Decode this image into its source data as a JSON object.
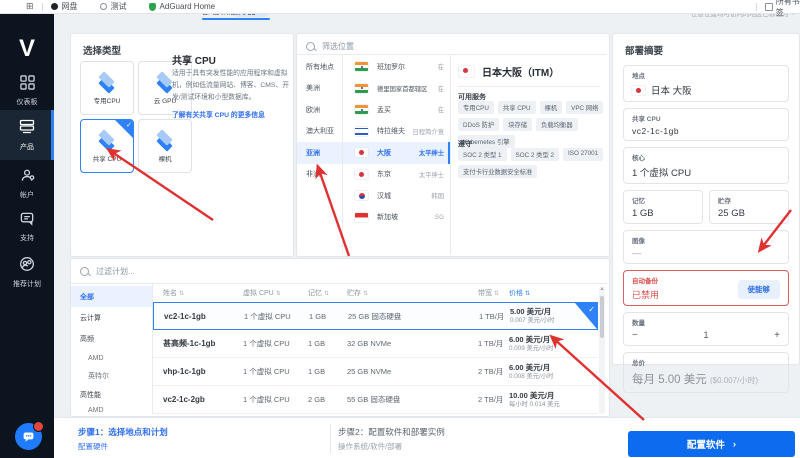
{
  "colors": {
    "accent": "#2f81f7",
    "brand_button": "#0d6bf0",
    "danger": "#d9534f",
    "sidebar_bg": "#0b141f"
  },
  "browser": {
    "bookmarks": [
      {
        "label": "网盘"
      },
      {
        "label": "测试"
      },
      {
        "label": "AdGuard Home"
      }
    ],
    "all_bookmarks": "所有书签"
  },
  "topstrip": {
    "tab": "部署新服务器",
    "hint": "任意位置均可访问的地区已标记为 ~"
  },
  "sidebar": {
    "logo": "V",
    "items": [
      {
        "label": "仪表板"
      },
      {
        "label": "产品"
      },
      {
        "label": "帐户"
      },
      {
        "label": "支持"
      },
      {
        "label": "推荐计划"
      }
    ]
  },
  "type_panel": {
    "title": "选择类型",
    "cards": [
      {
        "label": "专用CPU"
      },
      {
        "label": "云 GPU"
      },
      {
        "label": "共享 CPU"
      },
      {
        "label": "裸机"
      }
    ],
    "detail": {
      "title": "共享 CPU",
      "desc": "适用于具有突发性能的应用程序和虚拟机，例如低流量网站、博客、CMS、开发/测试环境和小型数据库。",
      "link": "了解有关共享 CPU 的更多信息"
    }
  },
  "location_panel": {
    "search_placeholder": "筛选位置",
    "regions": [
      {
        "label": "所有地点"
      },
      {
        "label": "美洲"
      },
      {
        "label": "欧洲"
      },
      {
        "label": "澳大利亚"
      },
      {
        "label": "亚洲"
      },
      {
        "label": "非洲"
      }
    ],
    "cities": [
      {
        "name": "班加罗尔",
        "meta": "在"
      },
      {
        "name": "德里国家首都辖区",
        "meta": "在"
      },
      {
        "name": "孟买",
        "meta": "在"
      },
      {
        "name": "特拉维夫",
        "meta": "日程简介意"
      },
      {
        "name": "大阪",
        "meta": "太平绅士"
      },
      {
        "name": "东京",
        "meta": "太平绅士"
      },
      {
        "name": "汉城",
        "meta": "韩国"
      },
      {
        "name": "新加坡",
        "meta": "SG"
      }
    ],
    "detail": {
      "title": "日本大阪（ITM）",
      "services_label": "可用服务",
      "services": [
        {
          "label": "专用CPU"
        },
        {
          "label": "共享 CPU"
        },
        {
          "label": "裸机"
        },
        {
          "label": "VPC 网络"
        },
        {
          "label": "DDoS 防护"
        },
        {
          "label": "块存储"
        },
        {
          "label": "负载均衡器"
        },
        {
          "label": "Kubernetes 引擎"
        }
      ],
      "compliance_label": "遵守",
      "compliance": [
        {
          "label": "SOC 2 类型 1"
        },
        {
          "label": "SOC 2 类型 2"
        },
        {
          "label": "ISO 27001"
        },
        {
          "label": "支付卡行业数据安全标准"
        }
      ]
    }
  },
  "plans_panel": {
    "search_placeholder": "过滤计划...",
    "filters": [
      {
        "label": "全部"
      },
      {
        "label": "云计算"
      },
      {
        "label": "高频"
      },
      {
        "label": "AMD"
      },
      {
        "label": "英特尔"
      },
      {
        "label": "高性能"
      },
      {
        "label": "AMD"
      }
    ],
    "columns": [
      {
        "label": "姓名"
      },
      {
        "label": "虚拟 CPU"
      },
      {
        "label": "记忆"
      },
      {
        "label": "贮存"
      },
      {
        "label": "带宽"
      },
      {
        "label": "价格"
      }
    ],
    "rows": [
      {
        "name": "vc2-1c-1gb",
        "cpu": "1 个虚拟 CPU",
        "mem": "1 GB",
        "storage": "25 GB 固态硬盘",
        "bw": "1 TB/月",
        "price": "5.00 美元/月",
        "price_sub": "0.007 美元/小时"
      },
      {
        "name": "甚高频-1c-1gb",
        "cpu": "1 个虚拟 CPU",
        "mem": "1 GB",
        "storage": "32 GB NVMe",
        "bw": "1 TB/月",
        "price": "6.00 美元/月",
        "price_sub": "0.009 美元/小时"
      },
      {
        "name": "vhp-1c-1gb",
        "cpu": "1 个虚拟 CPU",
        "mem": "1 GB",
        "storage": "25 GB NVMe",
        "bw": "2 TB/月",
        "price": "6.00 美元/月",
        "price_sub": "0.008 美元/小时"
      },
      {
        "name": "vc2-1c-2gb",
        "cpu": "1 个虚拟 CPU",
        "mem": "2 GB",
        "storage": "55 GB 固态硬盘",
        "bw": "2 TB/月",
        "price": "10.00 美元/月",
        "price_sub": "每小时 0.014 美元"
      }
    ]
  },
  "steps": {
    "step1": "步骤1：选择地点和计划",
    "step1_sub": "配置硬件",
    "step2": "步骤2：配置软件和部署实例",
    "step2_sub": "操作系统/软件/部署"
  },
  "summary": {
    "title": "部署摘要",
    "location_label": "地点",
    "location_value": "日本 大阪",
    "cpu_label": "共享 CPU",
    "cpu_value": "vc2-1c-1gb",
    "core_label": "核心",
    "core_value": "1 个虚拟 CPU",
    "mem_label": "记忆",
    "mem_value": "1 GB",
    "storage_label": "贮存",
    "storage_value": "25 GB",
    "image_label": "图像",
    "image_value": "—",
    "backup_label": "自动备份",
    "backup_status": "已禁用",
    "backup_button": "使能够",
    "qty_label": "数量",
    "qty_minus": "−",
    "qty_value": "1",
    "qty_plus": "+",
    "total_label": "总价",
    "total_value": "每月 5.00 美元",
    "total_sub": "($0.007/小时)",
    "deploy_button": "配置软件",
    "deploy_chevron": "›"
  }
}
